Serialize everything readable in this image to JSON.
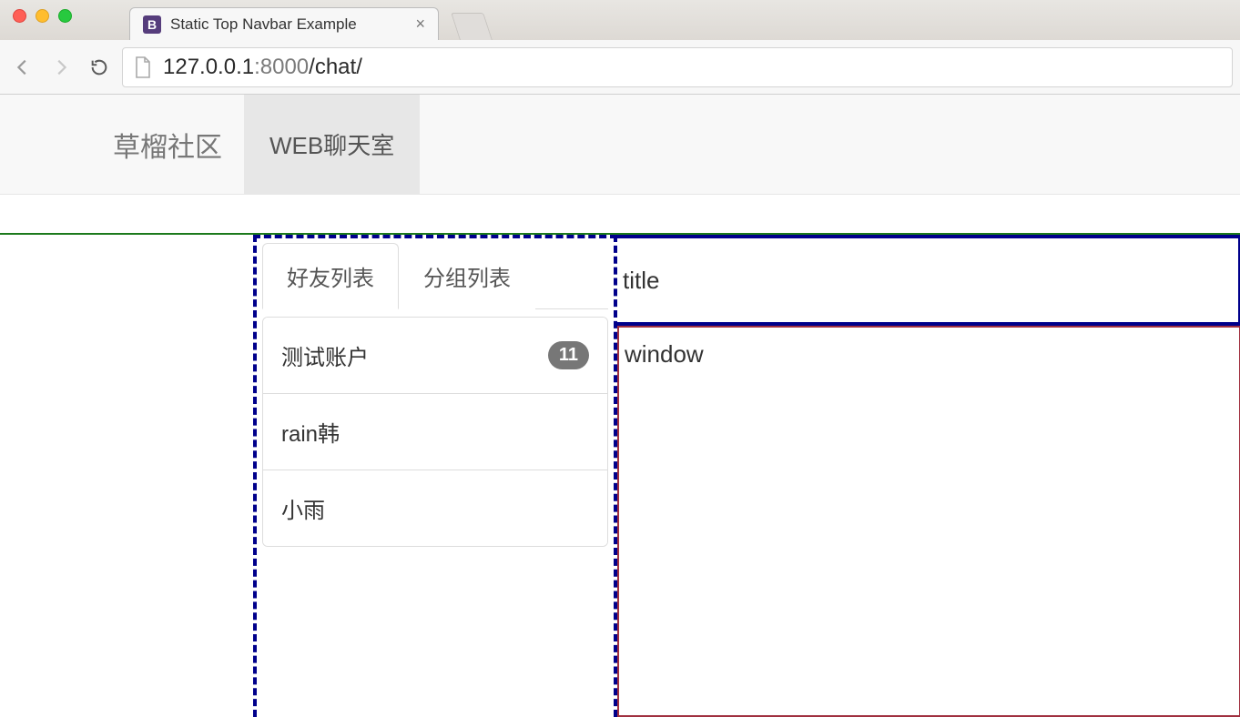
{
  "browser": {
    "tab_title": "Static Top Navbar Example",
    "url_host": "127.0.0.1",
    "url_port": ":8000",
    "url_path": "/chat/"
  },
  "navbar": {
    "brand": "草榴社区",
    "link_webchat": "WEB聊天室"
  },
  "left_panel": {
    "tabs": {
      "friends": "好友列表",
      "groups": "分组列表"
    },
    "friends": [
      {
        "name": "测试账户",
        "badge": "11"
      },
      {
        "name": "rain韩",
        "badge": ""
      },
      {
        "name": "小雨",
        "badge": ""
      }
    ]
  },
  "right_panel": {
    "title": "title",
    "window": "window"
  }
}
